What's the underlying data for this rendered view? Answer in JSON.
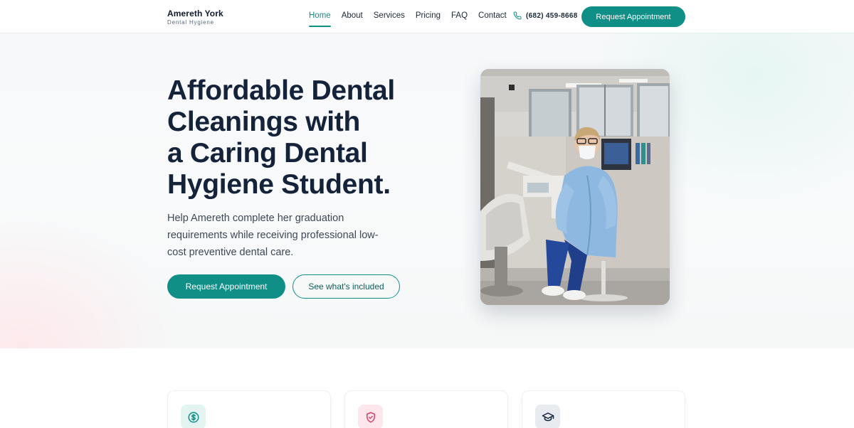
{
  "brand": {
    "name": "Amereth York",
    "subtitle": "Dental Hygiene"
  },
  "nav": {
    "items": [
      {
        "label": "Home",
        "active": true
      },
      {
        "label": "About"
      },
      {
        "label": "Services"
      },
      {
        "label": "Pricing"
      },
      {
        "label": "FAQ"
      },
      {
        "label": "Contact"
      }
    ]
  },
  "header": {
    "phone": "(682) 459-8668",
    "cta_label": "Request Appointment"
  },
  "hero": {
    "title_lines": [
      "Affordable Dental",
      "Cleanings with",
      "a Caring Dental",
      "Hygiene Student."
    ],
    "subtitle_lines": [
      "Help Amereth complete her graduation",
      "requirements while receiving professional low-",
      "cost preventive dental care."
    ],
    "primary_button": "Request Appointment",
    "secondary_button": "See what's included",
    "photo_icon": "hygienist-photo"
  },
  "cards": [
    {
      "icon": "dollar-icon",
      "icon_color": "#0f8f86",
      "bg": "#e3f4f1"
    },
    {
      "icon": "shield-icon",
      "icon_color": "#d6456b",
      "bg": "#fde6ec"
    },
    {
      "icon": "graduation-cap-icon",
      "icon_color": "#14233a",
      "bg": "#e8ebef"
    }
  ],
  "colors": {
    "accent": "#0f8f86",
    "heading": "#14233a",
    "text": "#3d4957"
  }
}
